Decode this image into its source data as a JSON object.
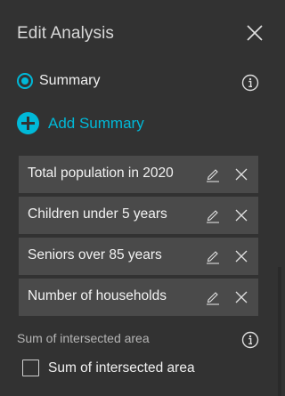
{
  "header": {
    "title": "Edit Analysis"
  },
  "summary_option": {
    "label": "Summary",
    "selected": true
  },
  "add_summary": {
    "label": "Add Summary"
  },
  "summary_items": [
    {
      "label": "Total population in 2020"
    },
    {
      "label": "Children under 5 years"
    },
    {
      "label": "Seniors over 85 years"
    },
    {
      "label": "Number of households"
    }
  ],
  "intersected_area": {
    "section_label": "Sum of intersected area",
    "checkbox_label": "Sum of intersected area",
    "checked": false
  },
  "colors": {
    "background": "#323232",
    "item_background": "#4a4a4a",
    "accent": "#00b9d8",
    "text": "#f0f0f0"
  },
  "icons": [
    "close-icon",
    "info-icon",
    "plus-circle-icon",
    "pencil-icon",
    "x-icon",
    "checkbox-icon"
  ]
}
